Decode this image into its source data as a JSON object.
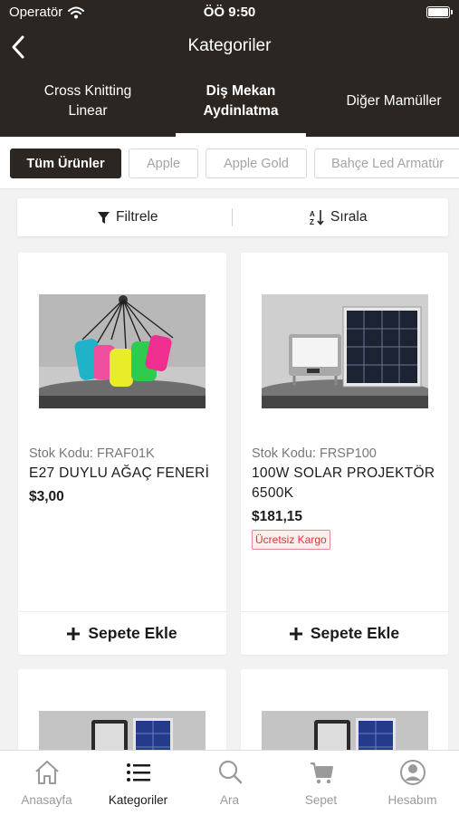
{
  "status_bar": {
    "carrier": "Operatör",
    "time": "ÖÖ 9:50"
  },
  "header": {
    "title": "Kategoriler"
  },
  "category_tabs": [
    {
      "line1": "Cross Knitting",
      "line2": "Linear"
    },
    {
      "line1": "Diş Mekan",
      "line2": "Aydinlatma",
      "active": true
    },
    {
      "line1": "Diğer Mamüller",
      "line2": ""
    }
  ],
  "chips": [
    "Tüm Ürünler",
    "Apple",
    "Apple Gold",
    "Bahçe Led Armatür"
  ],
  "toolbar": {
    "filter_label": "Filtrele",
    "sort_label": "Sırala"
  },
  "products": [
    {
      "stock_code": "Stok Kodu: FRAF01K",
      "name": "E27 DUYLU AĞAÇ FENERİ",
      "price": "$3,00",
      "add_label": "Sepete Ekle"
    },
    {
      "stock_code": "Stok Kodu: FRSP100",
      "name": "100W SOLAR PROJEKTÖR 6500K",
      "price": "$181,15",
      "badge": "Ücretsiz Kargo",
      "add_label": "Sepete Ekle"
    }
  ],
  "tab_bar": [
    {
      "label": "Anasayfa",
      "icon": "home-icon"
    },
    {
      "label": "Kategoriler",
      "icon": "list-icon",
      "active": true
    },
    {
      "label": "Ara",
      "icon": "search-icon"
    },
    {
      "label": "Sepet",
      "icon": "cart-icon"
    },
    {
      "label": "Hesabım",
      "icon": "account-icon"
    }
  ],
  "colors": {
    "header_bg": "#2b2622",
    "badge_red": "#d03b3b",
    "accent_dark": "#1b1b1b"
  }
}
